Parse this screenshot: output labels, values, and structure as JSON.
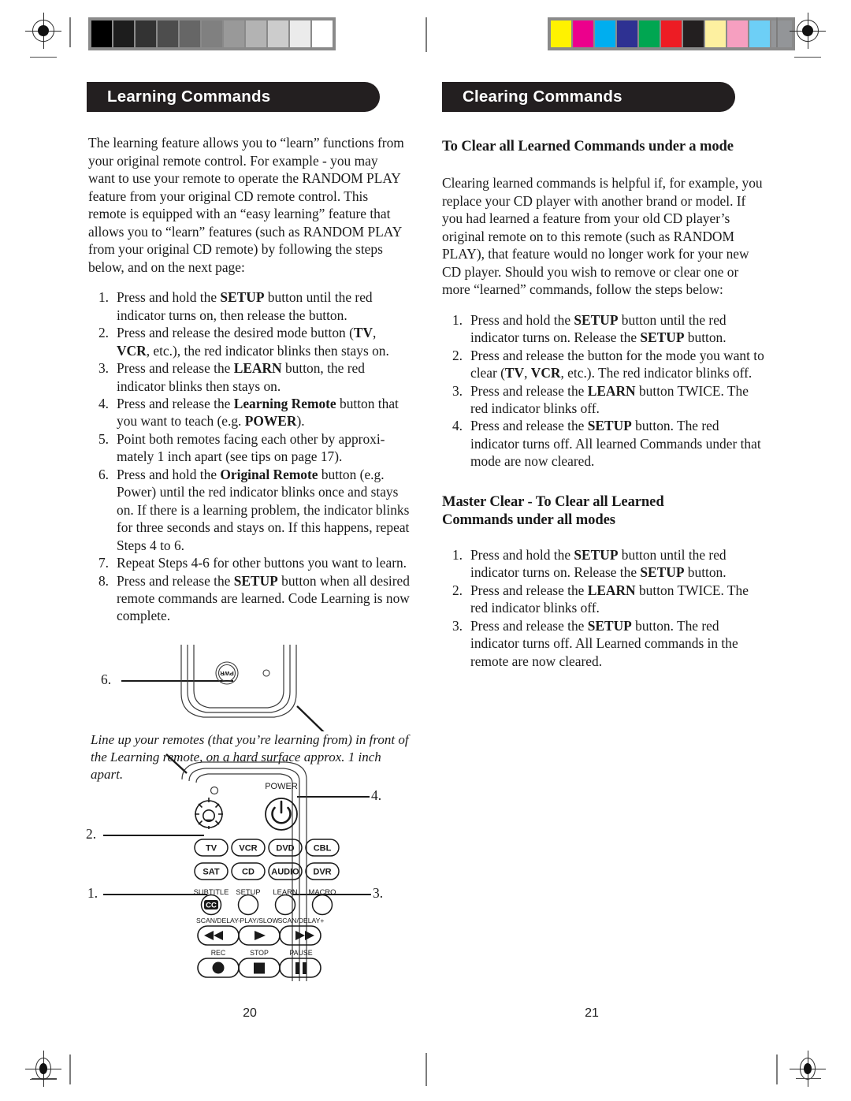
{
  "doc": {
    "left_page_number": "20",
    "right_page_number": "21"
  },
  "calibration": {
    "grayscale_label": "grayscale-step-wedge",
    "grayscale_steps": [
      "#000000",
      "#1d1d1d",
      "#333333",
      "#4d4d4d",
      "#666666",
      "#808080",
      "#999999",
      "#b3b3b3",
      "#cccccc",
      "#ebebeb",
      "#ffffff"
    ],
    "color_label": "color-control-bar",
    "color_steps": [
      "#fff200",
      "#ec008c",
      "#00aeef",
      "#2e3192",
      "#00a651",
      "#ed1c24",
      "#231f20",
      "#fdf0a0",
      "#f69fc0",
      "#6dcff6",
      "#939598"
    ]
  },
  "left_column": {
    "banner": "Learning Commands",
    "intro": "The learning feature allows you to “learn” functions from your original remote control. For example - you may want to use your remote to operate the RANDOM PLAY feature from your original CD remote control. This remote is equipped with an “easy learning” feature that allows you to “learn” features (such as RANDOM PLAY from your original CD remote) by following the steps below, and on the next page:",
    "steps": [
      {
        "num": "1.",
        "text_html": "Press and hold the <b>SETUP</b> button until the red indicator turns on, then release the button."
      },
      {
        "num": "2.",
        "text_html": "Press and release the desired mode button (<b>TV</b>, <b>VCR</b>, etc.), the red indicator blinks then stays on."
      },
      {
        "num": "3.",
        "text_html": "Press and release the <b>LEARN</b> button, the red indicator blinks then stays on."
      },
      {
        "num": "4.",
        "text_html": "Press and release the <b>Learning Remote</b> button that you want to teach (e.g. <b>POWER</b>)."
      },
      {
        "num": "5.",
        "text_html": "Point both remotes facing each other by approxi-mately 1 inch apart (see tips on page 17)."
      },
      {
        "num": "6.",
        "text_html": "Press and hold the <b>Original Remote</b> button (e.g. Power) until the red indicator blinks once and stays on. If there is a learning problem, the indicator blinks for three seconds and stays on. If this happens, repeat Steps 4 to 6."
      },
      {
        "num": "7.",
        "text_html": "Repeat Steps 4-6 for other buttons you want to learn."
      },
      {
        "num": "8.",
        "text_html": "Press and release the <b>SETUP</b> button when all desired remote commands are learned. Code Learning is now complete."
      }
    ],
    "figure_caption": "Line up your remotes (that you’re learning from) in front of the Learning remote, on a hard surface approx. 1 inch apart.",
    "callouts": {
      "c1": "1.",
      "c2": "2.",
      "c3": "3.",
      "c4": "4.",
      "c6": "6."
    }
  },
  "right_column": {
    "banner": "Clearing Commands",
    "subhead_1": "To Clear all Learned Commands under a mode",
    "intro": "Clearing learned commands is helpful if, for example, you replace your CD player with another brand or model. If you had learned a feature from your old CD player’s original remote on to this remote (such as RANDOM PLAY), that feature would no longer work for your new CD player. Should you wish to remove or clear one or more “learned” commands, follow the steps below:",
    "steps_1": [
      {
        "num": "1.",
        "text_html": "Press and hold the <b>SETUP</b> button until the red indicator turns on. Release the <b>SETUP</b> button."
      },
      {
        "num": "2.",
        "text_html": "Press and release the button for the mode you want to clear (<b>TV</b>, <b>VCR</b>, etc.). The red indicator blinks off."
      },
      {
        "num": "3.",
        "text_html": "Press and release the <b>LEARN</b> button TWICE.  The red indicator blinks off."
      },
      {
        "num": "4.",
        "text_html": "Press and release the <b>SETUP</b> button. The red indicator turns off. All learned Commands under that mode are now cleared."
      }
    ],
    "subhead_2_line1": "Master Clear - To Clear all Learned",
    "subhead_2_line2": "Commands under all modes",
    "steps_2": [
      {
        "num": "1.",
        "text_html": "Press and hold the <b>SETUP</b> button until the red indicator turns on. Release the <b>SETUP</b> button."
      },
      {
        "num": "2.",
        "text_html": "Press and release the <b>LEARN</b> button TWICE. The red indicator blinks off."
      },
      {
        "num": "3.",
        "text_html": "Press and release the <b>SETUP</b> button. The red indicator turns off. All Learned commands in the remote are now cleared."
      }
    ]
  },
  "remote_figure": {
    "original_remote_button": "PWR",
    "power_label": "POWER",
    "mode_row_1": [
      "TV",
      "VCR",
      "DVD",
      "CBL"
    ],
    "mode_row_2": [
      "SAT",
      "CD",
      "AUDIO",
      "DVR"
    ],
    "function_row_labels": [
      "SUBTITLE",
      "SETUP",
      "LEARN",
      "MACRO"
    ],
    "subtitle_button_glyph": "CC",
    "transport_row_1_labels": [
      "SCAN/DELAY-",
      "PLAY/SLOW",
      "SCAN/DELAY+"
    ],
    "transport_row_2_labels": [
      "REC",
      "STOP",
      "PAUSE"
    ]
  }
}
